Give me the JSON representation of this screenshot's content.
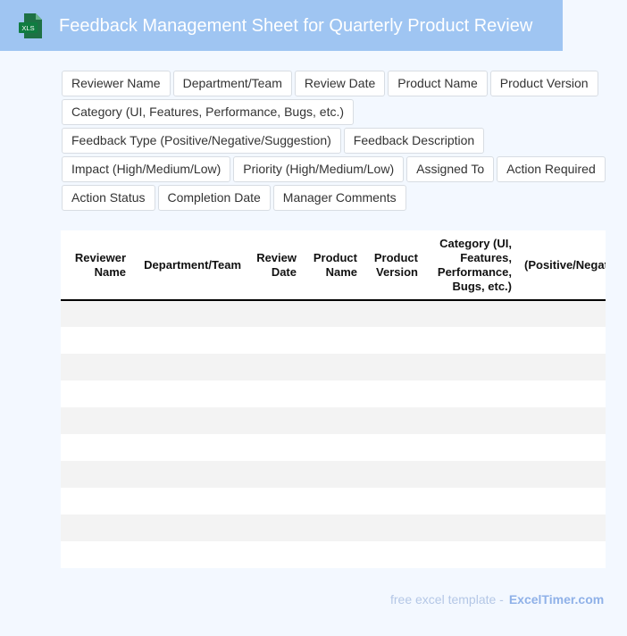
{
  "header": {
    "title": "Feedback Management Sheet for Quarterly Product Review",
    "icon": "xls-file-icon",
    "icon_label": "XLS",
    "bar_color": "#9fc5f2"
  },
  "fields": [
    "Reviewer Name",
    "Department/Team",
    "Review Date",
    "Product Name",
    "Product Version",
    "Category (UI, Features, Performance, Bugs, etc.)",
    "Feedback Type (Positive/Negative/Suggestion)",
    "Feedback Description",
    "Impact (High/Medium/Low)",
    "Priority (High/Medium/Low)",
    "Assigned To",
    "Action Required",
    "Action Status",
    "Completion Date",
    "Manager Comments"
  ],
  "table": {
    "headers": [
      "Reviewer Name",
      "Department/Team",
      "Review Date",
      "Product Name",
      "Product Version",
      "Category (UI, Features, Performance, Bugs, etc.)",
      "(Positive/Negative/Suggestion)"
    ],
    "row_count": 10,
    "row_colors": [
      "#f3f3f3",
      "#ffffff"
    ]
  },
  "footer": {
    "text": "free excel template -",
    "brand": "ExcelTimer.com"
  }
}
